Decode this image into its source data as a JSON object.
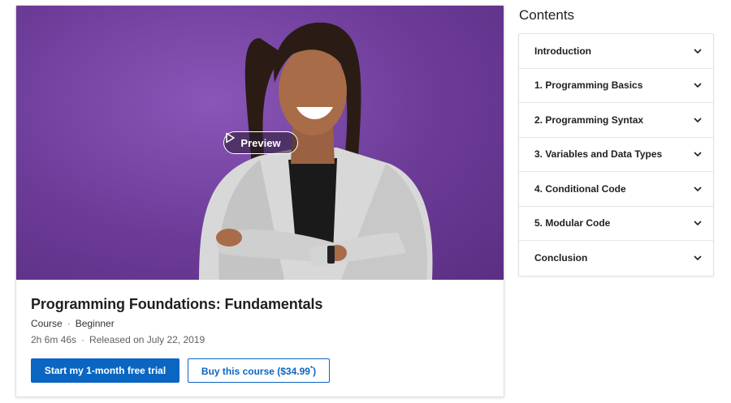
{
  "course": {
    "preview_label": "Preview",
    "title": "Programming Foundations: Fundamentals",
    "type": "Course",
    "level": "Beginner",
    "duration": "2h 6m 46s",
    "released": "Released on July 22, 2019",
    "separator": "·"
  },
  "actions": {
    "trial_label": "Start my 1-month free trial",
    "buy_label": "Buy this course ($34.99",
    "buy_suffix": ")",
    "buy_sup": "*"
  },
  "contents": {
    "heading": "Contents",
    "items": [
      {
        "label": "Introduction"
      },
      {
        "label": "1. Programming Basics"
      },
      {
        "label": "2. Programming Syntax"
      },
      {
        "label": "3. Variables and Data Types"
      },
      {
        "label": "4. Conditional Code"
      },
      {
        "label": "5. Modular Code"
      },
      {
        "label": "Conclusion"
      }
    ]
  },
  "colors": {
    "accent": "#0a66c2",
    "hero_bg": "#6c3b97"
  }
}
